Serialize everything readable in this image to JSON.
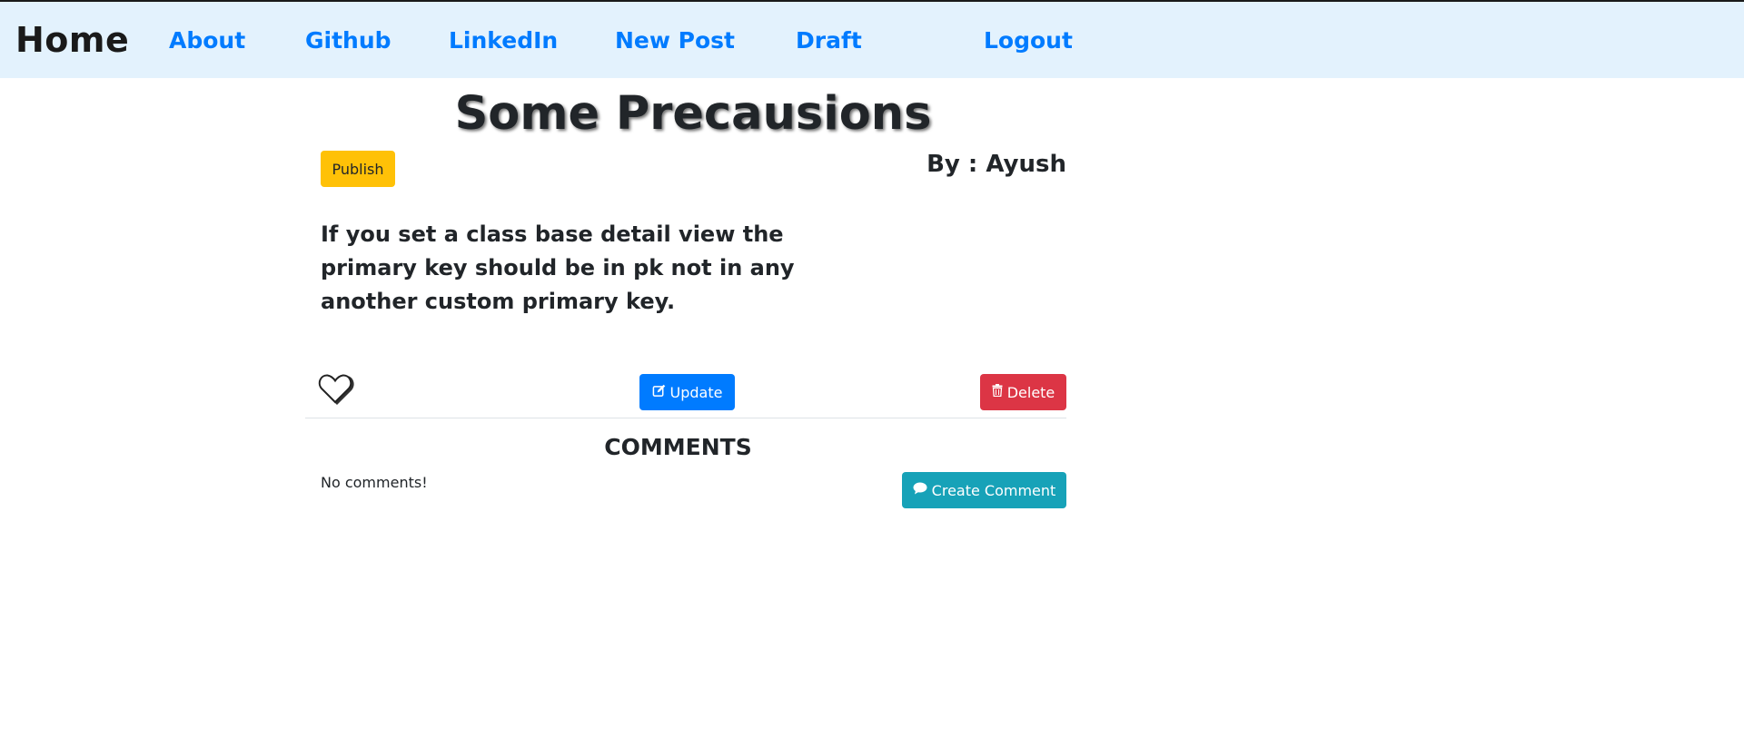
{
  "navbar": {
    "brand": "Home",
    "links": [
      "About",
      "Github",
      "LinkedIn",
      "New Post",
      "Draft",
      "Logout"
    ]
  },
  "post": {
    "title": "Some Precausions",
    "publish_label": "Publish",
    "author": "By : Ayush",
    "body": "If you set a class base detail view the primary key should be in pk not in any another custom primary key.",
    "update_label": "Update",
    "delete_label": "Delete"
  },
  "comments": {
    "title": "COMMENTS",
    "empty_text": "No comments!",
    "create_label": "Create Comment"
  },
  "colors": {
    "navbar_bg": "#e3f2fd",
    "link": "#007bff",
    "publish": "#ffc107",
    "update": "#007bff",
    "delete": "#dc3545",
    "comment": "#17a2b8"
  },
  "icons": {
    "like": "heart-icon",
    "update": "edit-icon",
    "delete": "trash-icon",
    "comment": "comment-icon"
  }
}
